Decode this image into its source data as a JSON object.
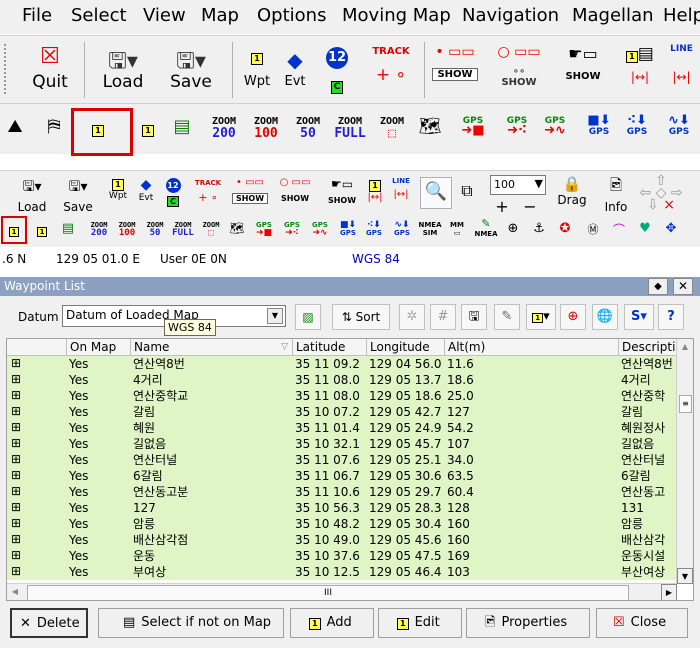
{
  "menu": [
    "File",
    "Select",
    "View",
    "Map",
    "Options",
    "Moving Map",
    "Navigation",
    "Magellan",
    "Help"
  ],
  "toolbar_main": {
    "quit": "Quit",
    "load": "Load",
    "save": "Save",
    "wpt": "Wpt",
    "evt": "Evt",
    "track": "TRACK",
    "show": "SHOW",
    "oshow": "SHOW",
    "line": "LINE"
  },
  "toolbar_zoom": {
    "zoom_word": "ZOOM",
    "levels": [
      "200",
      "100",
      "50",
      "FULL"
    ],
    "gps": "GPS"
  },
  "toolbar_small": {
    "load": "Load",
    "save": "Save",
    "wpt": "Wpt",
    "evt": "Evt",
    "track": "TRACK",
    "show": "SHOW",
    "zoom_value": "100",
    "drag": "Drag",
    "info": "Info",
    "zoom_word": "ZOOM",
    "levels": [
      "200",
      "100",
      "50",
      "FULL"
    ],
    "gps": "GPS",
    "nmea": "NMEA",
    "sim": "SIM",
    "mm": "MM"
  },
  "status": {
    "lat": ".6 N",
    "lon": "129 05 01.0 E",
    "user": "User 0E  0N",
    "datum": "WGS 84"
  },
  "waypoint_window": {
    "title": "Waypoint List",
    "datum_label": "Datum",
    "datum_value": "Datum of Loaded Map",
    "tooltip": "WGS 84",
    "sort": "Sort",
    "columns": [
      "On Map",
      "Name",
      "Latitude",
      "Longitude",
      "Alt(m)",
      "Descriptio"
    ],
    "rows": [
      {
        "onmap": "Yes",
        "name": "연산역8번",
        "lat": "35 11 09.2",
        "lon": "129 04 56.0",
        "alt": "11.6",
        "desc": "연산역8번"
      },
      {
        "onmap": "Yes",
        "name": "4거리",
        "lat": "35 11 08.0",
        "lon": "129 05 13.7",
        "alt": "18.6",
        "desc": "4거리"
      },
      {
        "onmap": "Yes",
        "name": "연산중학교",
        "lat": "35 11 08.0",
        "lon": "129 05 18.6",
        "alt": "25.0",
        "desc": "연산중학"
      },
      {
        "onmap": "Yes",
        "name": "갈림",
        "lat": "35 10 07.2",
        "lon": "129 05 42.7",
        "alt": "127",
        "desc": "갈림"
      },
      {
        "onmap": "Yes",
        "name": "혜원",
        "lat": "35 11 01.4",
        "lon": "129 05 24.9",
        "alt": "54.2",
        "desc": "혜원정사"
      },
      {
        "onmap": "Yes",
        "name": "길없음",
        "lat": "35 10 32.1",
        "lon": "129 05 45.7",
        "alt": "107",
        "desc": "길없음"
      },
      {
        "onmap": "Yes",
        "name": "연산터널",
        "lat": "35 11 07.6",
        "lon": "129 05 25.1",
        "alt": "34.0",
        "desc": "연산터널"
      },
      {
        "onmap": "Yes",
        "name": "6갈림",
        "lat": "35 11 06.7",
        "lon": "129 05 30.6",
        "alt": "63.5",
        "desc": "6갈림"
      },
      {
        "onmap": "Yes",
        "name": "연산동고분",
        "lat": "35 11 10.6",
        "lon": "129 05 29.7",
        "alt": "60.4",
        "desc": "연산동고"
      },
      {
        "onmap": "Yes",
        "name": "127",
        "lat": "35 10 56.3",
        "lon": "129 05 28.3",
        "alt": "128",
        "desc": "131"
      },
      {
        "onmap": "Yes",
        "name": "암릉",
        "lat": "35 10 48.2",
        "lon": "129 05 30.4",
        "alt": "160",
        "desc": "암릉"
      },
      {
        "onmap": "Yes",
        "name": "배산삼각점",
        "lat": "35 10 49.0",
        "lon": "129 05 45.6",
        "alt": "160",
        "desc": "배산삼각"
      },
      {
        "onmap": "Yes",
        "name": "운동",
        "lat": "35 10 37.6",
        "lon": "129 05 47.5",
        "alt": "169",
        "desc": "운동시설"
      },
      {
        "onmap": "Yes",
        "name": "부여상",
        "lat": "35 10 12.5",
        "lon": "129 05 46.4",
        "alt": "103",
        "desc": "부산여상"
      }
    ],
    "buttons": {
      "delete": "Delete",
      "select_not_on_map": "Select if not on Map",
      "add": "Add",
      "edit": "Edit",
      "properties": "Properties",
      "close": "Close"
    },
    "hscroll_grip": "III"
  },
  "colors": {
    "row_bg": "#dff5c6",
    "highlight_frame": "#dd0000",
    "title_bar": "#8ca0c0"
  }
}
